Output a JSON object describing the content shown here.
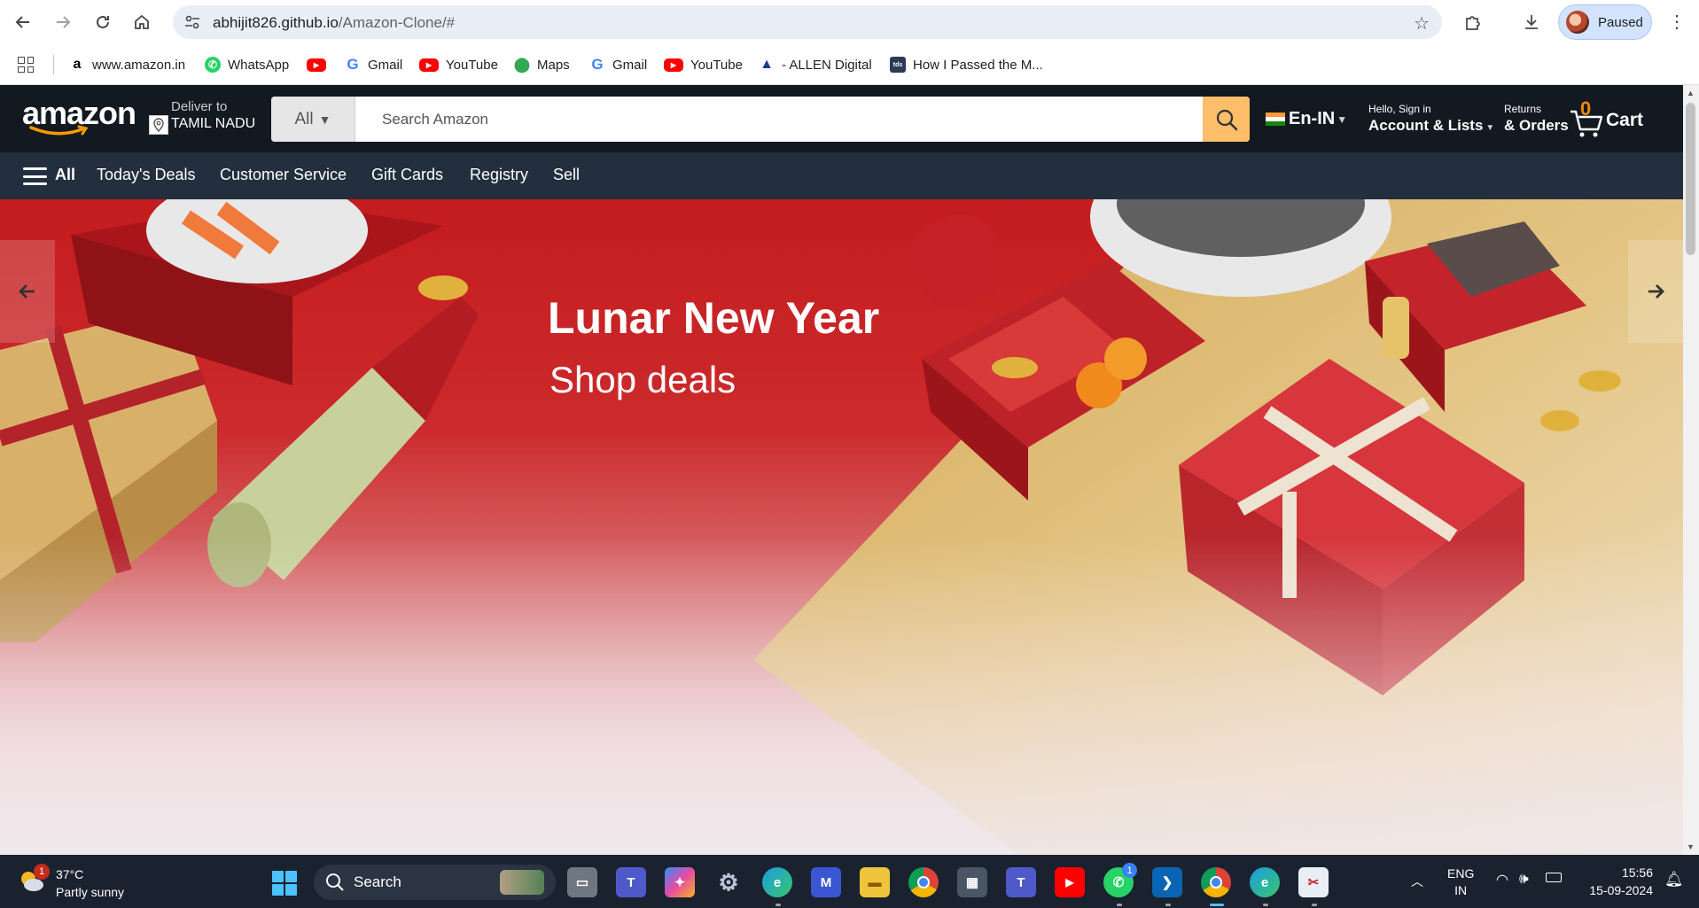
{
  "browser": {
    "url_host": "abhijit826.github.io",
    "url_path": "/Amazon-Clone/#",
    "profile_status": "Paused",
    "bookmarks": [
      {
        "label": "www.amazon.in",
        "icon": "amazon-icon"
      },
      {
        "label": "WhatsApp",
        "icon": "whatsapp-icon"
      },
      {
        "label": "",
        "icon": "youtube-icon"
      },
      {
        "label": "Gmail",
        "icon": "google-icon"
      },
      {
        "label": "YouTube",
        "icon": "youtube-icon"
      },
      {
        "label": "Maps",
        "icon": "maps-icon"
      },
      {
        "label": "Gmail",
        "icon": "google-icon"
      },
      {
        "label": "YouTube",
        "icon": "youtube-icon"
      },
      {
        "label": "- ALLEN Digital",
        "icon": "allen-icon"
      },
      {
        "label": "How I Passed the M...",
        "icon": "tds-icon"
      }
    ]
  },
  "amazon": {
    "logo": "amazon",
    "deliver_line1": "Deliver to",
    "deliver_line2": "TAMIL NADU",
    "search_category": "All",
    "search_placeholder": "Search Amazon",
    "language": "En-IN",
    "account_line1": "Hello, Sign in",
    "account_line2": "Account & Lists",
    "orders_line1": "Returns",
    "orders_line2": "& Orders",
    "cart_count": "0",
    "cart_label": "Cart",
    "menu_all": "All",
    "nav_items": [
      "Today's Deals",
      "Customer Service",
      "Gift Cards",
      "Registry",
      "Sell"
    ],
    "hero_title": "Lunar New Year",
    "hero_subtitle": "Shop deals",
    "colors": {
      "nav": "#131921",
      "subnav": "#232f3e",
      "search_button": "#febd69",
      "hero_red": "#c41c1f"
    }
  },
  "taskbar": {
    "temperature": "37°C",
    "weather": "Partly sunny",
    "weather_badge": "1",
    "search_label": "Search",
    "whatsapp_badge": "1",
    "lang_line1": "ENG",
    "lang_line2": "IN",
    "time": "15:56",
    "date": "15-09-2024"
  }
}
